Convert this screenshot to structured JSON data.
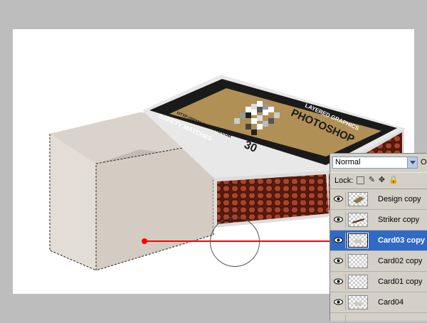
{
  "layers_panel": {
    "blend_mode": "Normal",
    "opacity_label": "Opac",
    "lock_label": "Lock:",
    "layers": [
      {
        "name": "Design copy",
        "thumb": "design-thumb",
        "selected": false
      },
      {
        "name": "Striker copy",
        "thumb": "striker-thumb",
        "selected": false
      },
      {
        "name": "Card03 copy",
        "thumb": "card-thumb",
        "selected": true
      },
      {
        "name": "Card02 copy",
        "thumb": "transparent-thumb",
        "selected": false
      },
      {
        "name": "Card01 copy",
        "thumb": "transparent-thumb",
        "selected": false
      },
      {
        "name": "Card04",
        "thumb": "card-thumb",
        "selected": false
      }
    ]
  },
  "label": {
    "brand": "LAYERED GRAPHICS",
    "title": "PHOTOSHOP",
    "number": "30",
    "url": "HTTP://WWW.PSDTUTS.COM",
    "subtitle": "SAFETY MATCHES"
  },
  "colors": {
    "workspace": "#bdbdbd",
    "canvas": "#ffffff",
    "label_gold": "#b09055",
    "label_dark": "#1a1a1a",
    "striker_brown": "#7a2a14",
    "tray": "#cfc7bd",
    "selection_blue": "#316ac5",
    "pointer_red": "#ff0000"
  }
}
